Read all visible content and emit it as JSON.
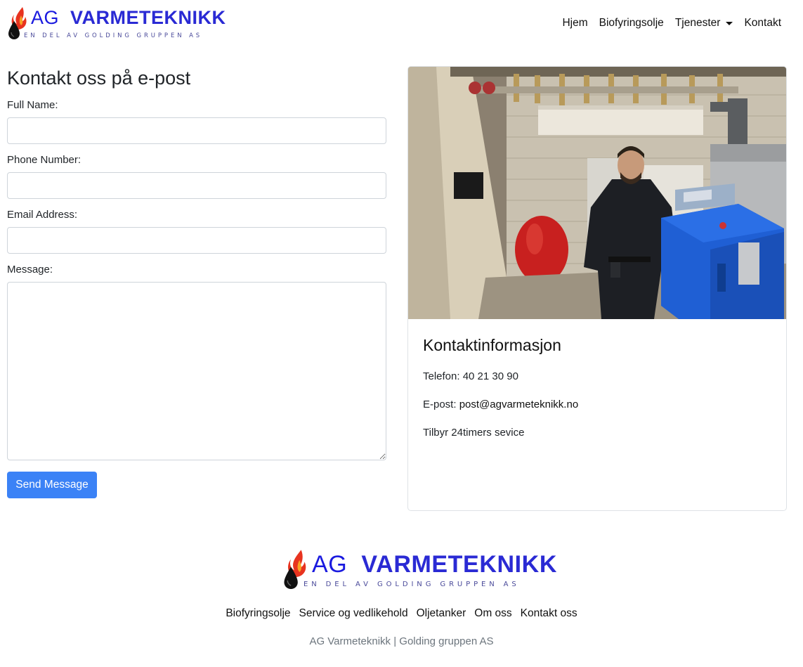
{
  "brand": {
    "name_ag": "AG",
    "name_rest": "VARMETEKNIKK",
    "tagline": "EN DEL AV GOLDING GRUPPEN AS",
    "icon": "flame-oil-drop-icon",
    "color_text": "#2a2ad4",
    "color_flame": "#e8331f",
    "color_drop": "#111111"
  },
  "nav": {
    "items": [
      "Hjem",
      "Biofyringsolje",
      "Tjenester",
      "Kontakt"
    ]
  },
  "form": {
    "title": "Kontakt oss på e-post",
    "full_name_label": "Full Name:",
    "phone_label": "Phone Number:",
    "email_label": "Email Address:",
    "message_label": "Message:",
    "submit_label": "Send Message",
    "submit_color": "#3b82f6"
  },
  "contact": {
    "photo": "photo of a technician standing beside a blue boiler in a boiler room",
    "title": "Kontaktinformasjon",
    "phone": "Telefon: 40 21 30 90",
    "email_prefix": "E-post: ",
    "email": "post@agvarmeteknikk.no",
    "service": "Tilbyr 24timers sevice"
  },
  "footer": {
    "links": [
      "Biofyringsolje",
      "Service og vedlikehold",
      "Oljetanker",
      "Om oss",
      "Kontakt oss"
    ],
    "copy": "AG Varmeteknikk | Golding gruppen AS"
  }
}
